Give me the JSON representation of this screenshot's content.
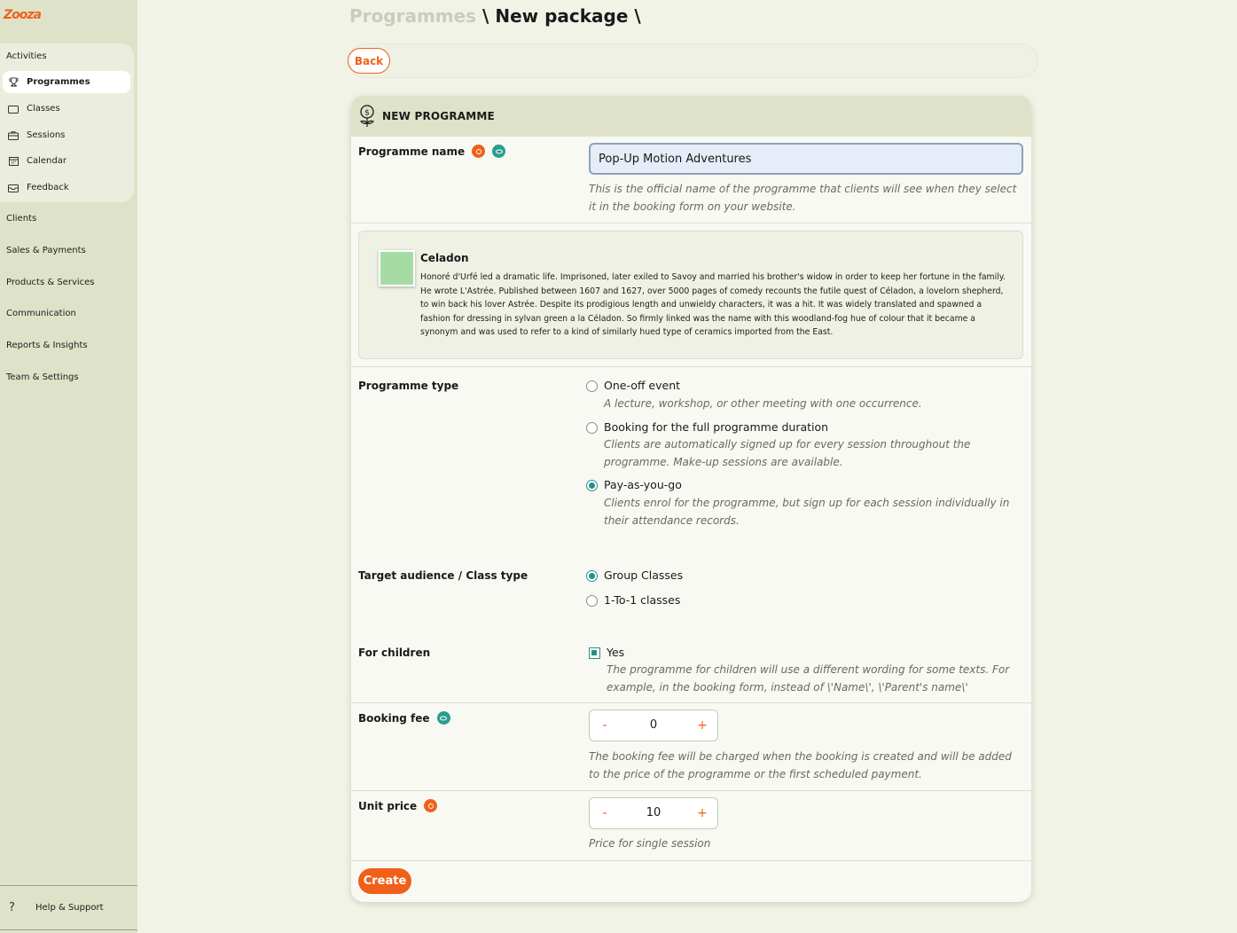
{
  "brand": {
    "logo_text": "Zooza",
    "accent": "#f0601a",
    "teal": "#2a8f86"
  },
  "sidebar": {
    "section_title": "Activities",
    "activity_items": [
      {
        "label": "Programmes",
        "icon": "trophy-icon",
        "active": true
      },
      {
        "label": "Classes",
        "icon": "folder-icon"
      },
      {
        "label": "Sessions",
        "icon": "briefcase-icon"
      },
      {
        "label": "Calendar",
        "icon": "calendar-icon"
      },
      {
        "label": "Feedback",
        "icon": "inbox-icon"
      }
    ],
    "top_items": [
      "Clients",
      "Sales & Payments",
      "Products & Services",
      "Communication",
      "Reports & Insights",
      "Team & Settings"
    ],
    "help_icon": "?",
    "help_label": "Help & Support"
  },
  "breadcrumb": {
    "parent": "Programmes",
    "sep1": " \\ ",
    "current": "New package",
    "sep2": " \\"
  },
  "toolbar": {
    "back_label": "Back"
  },
  "card": {
    "title": "NEW PROGRAMME",
    "programme_name": {
      "label": "Programme name",
      "value": "Pop-Up Motion Adventures",
      "help": "This is the official name of the programme that clients will see when they select it in the booking form on your website."
    },
    "color": {
      "name": "Celadon",
      "hex": "#a6dca4",
      "description": "Honoré d'Urfé led a dramatic life. Imprisoned, later exiled to Savoy and married his brother's widow in order to keep her fortune in the family. He wrote L'Astrée. Published between 1607 and 1627, over 5000 pages of comedy recounts the futile quest of Céladon, a lovelorn shepherd, to win back his lover Astrée. Despite its prodigious length and unwieldy characters, it was a hit. It was widely translated and spawned a fashion for dressing in sylvan green a la Céladon. So firmly linked was the name with this woodland-fog hue of colour that it became a synonym and was used to refer to a kind of similarly hued type of ceramics imported from the East."
    },
    "programme_type": {
      "label": "Programme type",
      "options": [
        {
          "label": "One-off event",
          "desc": "A lecture, workshop, or other meeting with one occurrence.",
          "selected": false
        },
        {
          "label": "Booking for the full programme duration",
          "desc": "Clients are automatically signed up for every session throughout the programme. Make-up sessions are available.",
          "selected": false
        },
        {
          "label": "Pay-as-you-go",
          "desc": "Clients enrol for the programme, but sign up for each session individually in their attendance records.",
          "selected": true
        }
      ]
    },
    "audience": {
      "label": "Target audience / Class type",
      "options": [
        {
          "label": "Group Classes",
          "selected": true
        },
        {
          "label": "1-To-1 classes",
          "selected": false
        }
      ]
    },
    "children": {
      "label": "For children",
      "checkbox_label": "Yes",
      "checked": true,
      "help": "The programme for children will use a different wording for some texts. For example, in the booking form, instead of \\'Name\\', \\'Parent's name\\'"
    },
    "booking_fee": {
      "label": "Booking fee",
      "value": "0",
      "minus": "-",
      "plus": "+",
      "help": "The booking fee will be charged when the booking is created and will be added to the price of the programme or the first scheduled payment."
    },
    "unit_price": {
      "label": "Unit price",
      "value": "10",
      "minus": "-",
      "plus": "+",
      "help": "Price for single session"
    },
    "create_label": "Create"
  }
}
